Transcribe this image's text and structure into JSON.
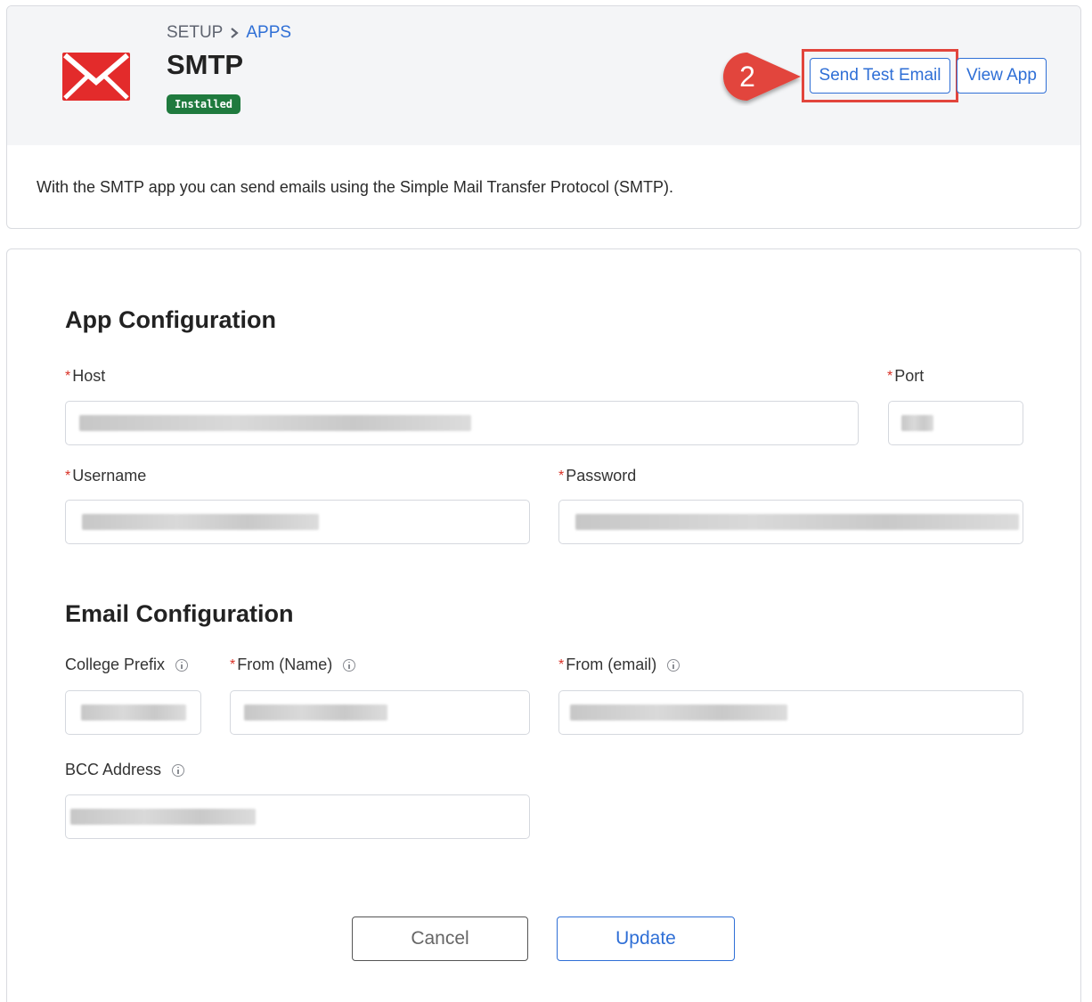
{
  "breadcrumb": {
    "setup": "SETUP",
    "separator_icon": "chevron-right-icon",
    "apps": "APPS"
  },
  "app": {
    "title": "SMTP",
    "status": "Installed",
    "description": "With the SMTP app you can send emails using the Simple Mail Transfer Protocol (SMTP).",
    "logo_icon": "envelope-icon",
    "logo_color": "#e32b2b"
  },
  "actions": {
    "send_test_email": "Send Test Email",
    "view_app": "View App"
  },
  "annotation": {
    "step": "2",
    "color": "#e2453c"
  },
  "app_config": {
    "title": "App Configuration",
    "host_label": "Host",
    "port_label": "Port",
    "username_label": "Username",
    "password_label": "Password"
  },
  "email_config": {
    "title": "Email Configuration",
    "college_prefix_label": "College Prefix",
    "from_name_label": "From (Name)",
    "from_email_label": "From (email)",
    "bcc_label": "BCC Address"
  },
  "required_marker": "*",
  "footer": {
    "cancel": "Cancel",
    "update": "Update"
  },
  "colors": {
    "accent": "#2f6fd6",
    "badge": "#1f7a3e",
    "required": "#d93025"
  }
}
